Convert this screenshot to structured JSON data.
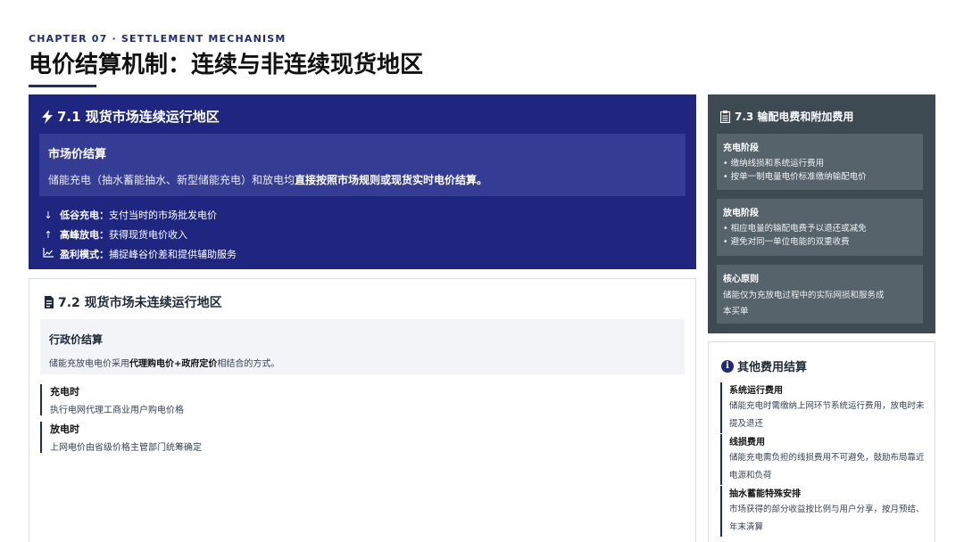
{
  "header": {
    "chapter": "CHAPTER 07 · SETTLEMENT MECHANISM",
    "title": "电价结算机制：连续与非连续现货地区"
  },
  "section71": {
    "title": "7.1 现货市场连续运行地区",
    "icon": "lightning-icon",
    "box_title": "市场价结算",
    "box_text_prefix": "储能充电（抽水蓄能抽水、新型储能充电）和放电均",
    "box_text_bold": "直接按照市场规则或现货实时电价结算。",
    "items": [
      {
        "icon": "arrow-down-icon",
        "label": "低谷充电：",
        "text": "支付当时的市场批发电价"
      },
      {
        "icon": "arrow-up-icon",
        "label": "高峰放电：",
        "text": "获得现货电价收入"
      },
      {
        "icon": "line-chart-icon",
        "label": "盈利模式：",
        "text": "捕捉峰谷价差和提供辅助服务"
      }
    ]
  },
  "section72": {
    "title": "7.2 现货市场未连续运行地区",
    "icon": "document-icon",
    "box_title": "行政价结算",
    "box_text_prefix": "储能充放电电价采用",
    "box_text_bold": "代理购电价+政府定价",
    "box_text_suffix": "相结合的方式。",
    "phases": [
      {
        "title": "充电时",
        "text": "执行电网代理工商业用户购电价格"
      },
      {
        "title": "放电时",
        "text": "上网电价由省级价格主管部门统筹确定"
      }
    ]
  },
  "section73": {
    "title": "7.3 输配电费和附加费用",
    "icon": "clipboard-icon",
    "boxes": [
      {
        "title": "充电阶段",
        "lines": [
          "• 缴纳线损和系统运行费用",
          "• 按单一制电量电价标准缴纳输配电价"
        ]
      },
      {
        "title": "放电阶段",
        "lines": [
          "• 相应电量的输配电费予以退还或减免",
          "• 避免对同一单位电能的双重收费"
        ]
      },
      {
        "title": "核心原则",
        "lines": [
          "储能仅为充放电过程中的实际网损和服务成",
          "本买单"
        ]
      }
    ]
  },
  "other": {
    "title": "其他费用结算",
    "icon": "info-icon",
    "icon_glyph": "i",
    "items": [
      {
        "title": "系统运行费用",
        "text": "储能充电时需缴纳上网环节系统运行费用，放电时未提及退还"
      },
      {
        "title": "线损费用",
        "text": "储能充电需负担的线损费用不可避免，鼓励布局靠近电源和负荷"
      },
      {
        "title": "抽水蓄能特殊安排",
        "text": "市场获得的部分收益按比例与用户分享，按月预结、年末清算"
      }
    ]
  },
  "colors": {
    "navy": "#1e2680",
    "slate": "#3e4a52",
    "accent": "#1e2a78"
  }
}
